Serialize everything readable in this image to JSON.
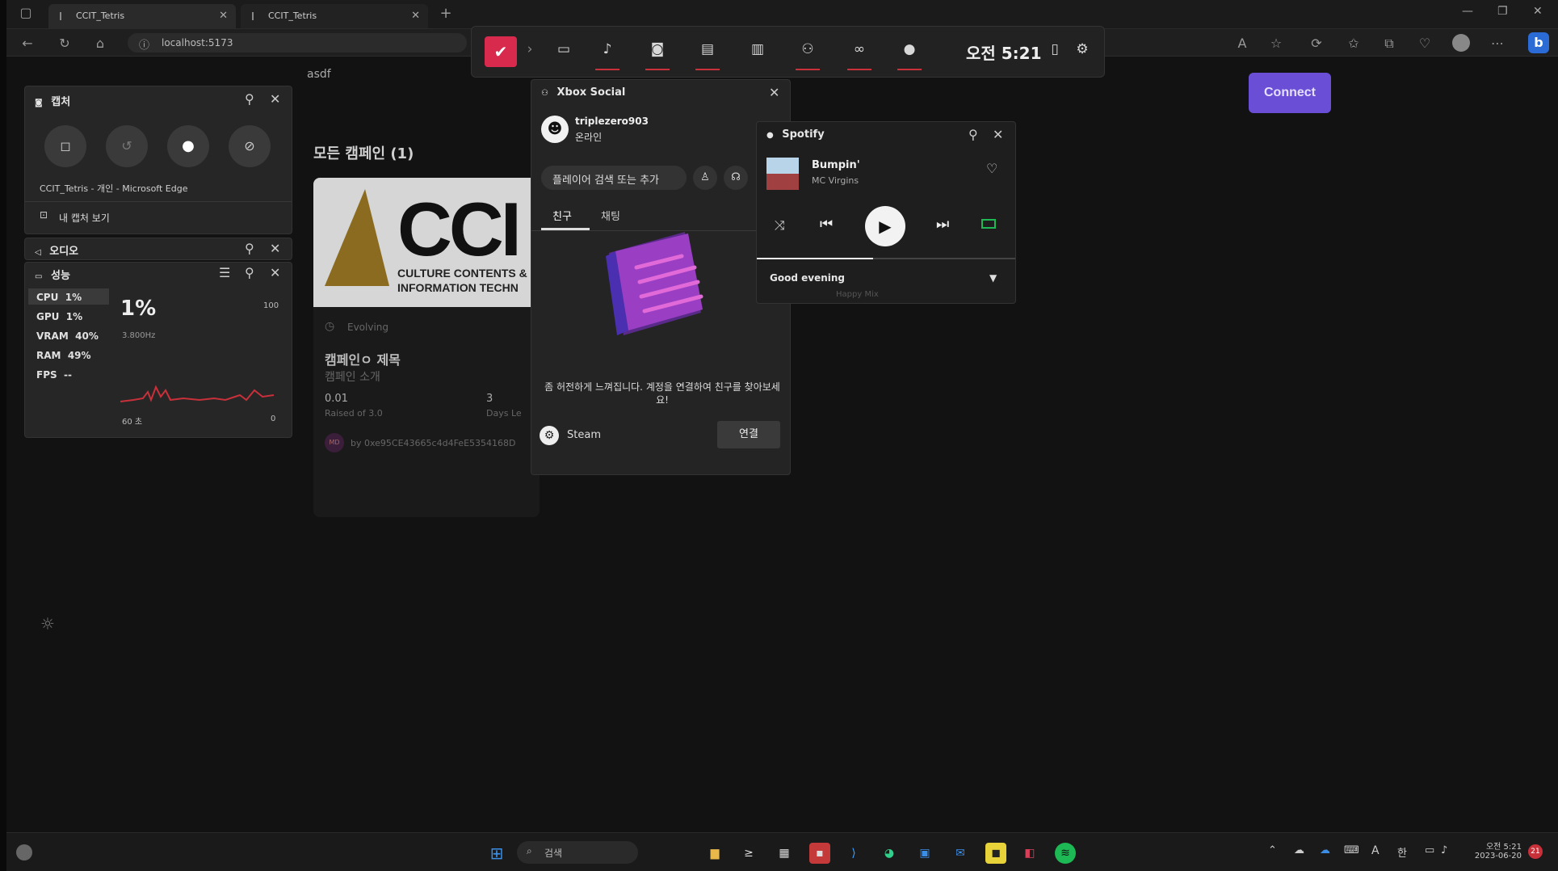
{
  "browser": {
    "tabs": [
      {
        "title": "CCIT_Tetris"
      },
      {
        "title": "CCIT_Tetris"
      }
    ],
    "url": "localhost:5173"
  },
  "page": {
    "search_value": "asdf",
    "connect_label": "Connect",
    "campaigns_heading": "모든 캠페인 (1)",
    "card": {
      "logo_text": "CCI",
      "logo_sub1": "CULTURE CONTENTS &",
      "logo_sub2": "INFORMATION TECHN",
      "status": "Evolving",
      "title": "캠페인ㅇ 제목",
      "description": "캠페인 소개",
      "raised": "0.01",
      "raised_label": "Raised of 3.0",
      "days": "3",
      "days_label": "Days Le",
      "owner_badge": "MD",
      "owner": "by 0xe95CE43665c4d4FeE5354168D"
    }
  },
  "gamebar": {
    "time": "오전 5:21",
    "icons": [
      "widget-menu-icon",
      "capture-icon",
      "audio-icon",
      "capture-widget-icon",
      "performance-icon",
      "resources-icon",
      "xbox-social-icon",
      "looking-for-group-icon",
      "spotify-icon"
    ]
  },
  "capture": {
    "title": "캡처",
    "source": "CCIT_Tetris - 개인 - Microsoft Edge",
    "see_captures": "내 캡처 보기"
  },
  "audio": {
    "title": "오디오"
  },
  "performance": {
    "title": "성능",
    "rows": [
      {
        "label": "CPU",
        "value": "1%"
      },
      {
        "label": "GPU",
        "value": "1%"
      },
      {
        "label": "VRAM",
        "value": "40%"
      },
      {
        "label": "RAM",
        "value": "49%"
      },
      {
        "label": "FPS",
        "value": "--"
      }
    ],
    "big_value": "1%",
    "freq": "3.800Hz",
    "max": "100",
    "min": "0",
    "time_span": "60 초"
  },
  "social": {
    "title": "Xbox Social",
    "username": "triplezero903",
    "status": "온라인",
    "search_placeholder": "플레이어 검색 또는 추가",
    "tabs": [
      "친구",
      "채팅"
    ],
    "empty_message": "좀 허전하게 느껴집니다. 계정을 연결하여 친구를 찾아보세요!",
    "steam_label": "Steam",
    "connect_label": "연결"
  },
  "spotify": {
    "title": "Spotify",
    "track": "Bumpin'",
    "artist": "MC Virgins",
    "playlist_header": "Good evening",
    "playlist_hint": "Happy Mix",
    "progress": 0.45
  },
  "taskbar": {
    "search_label": "검색",
    "time": "오전 5:21",
    "date": "2023-06-20",
    "ime": "한",
    "notification_count": "21"
  },
  "colors": {
    "accent": "#6a4fd6",
    "gamebar_underline": "#c8303a",
    "spotify_green": "#1db954"
  }
}
